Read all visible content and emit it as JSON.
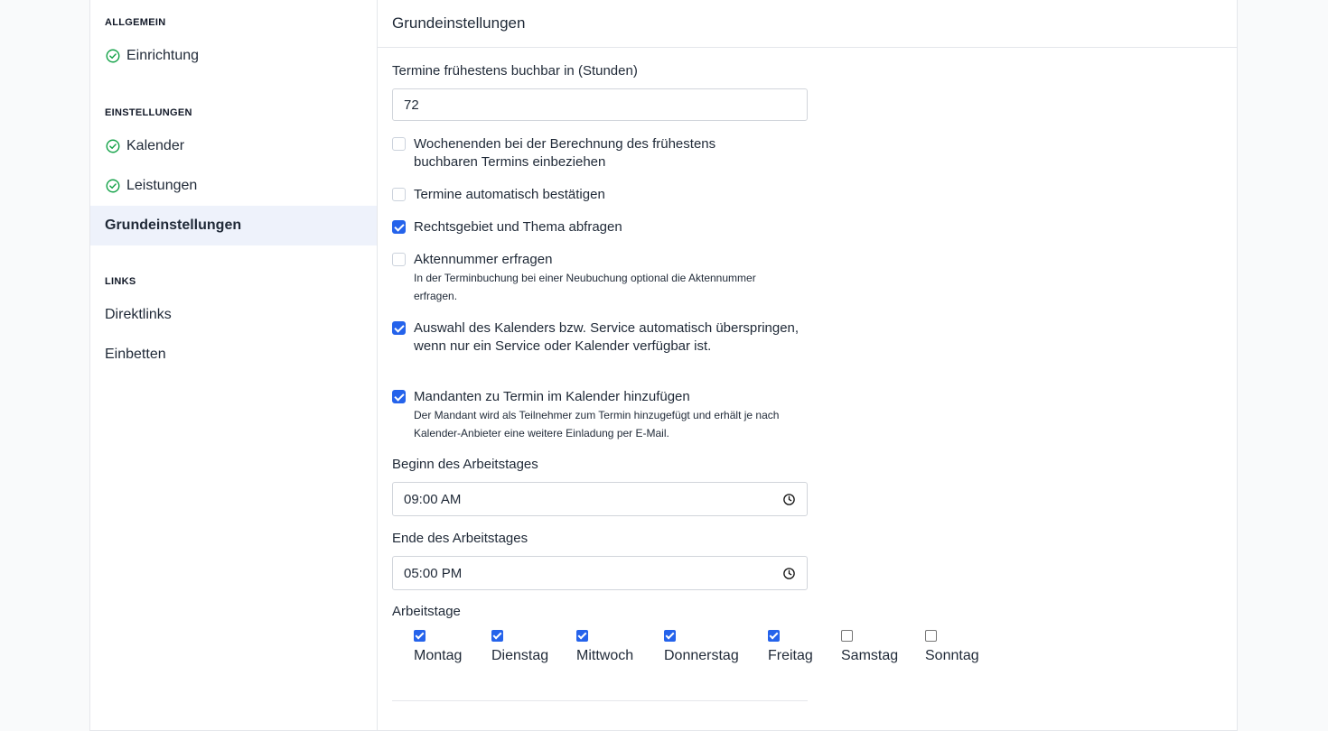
{
  "sidebar": {
    "sections": [
      {
        "title": "ALLGEMEIN",
        "items": [
          {
            "label": "Einrichtung",
            "done": true
          }
        ]
      },
      {
        "title": "EINSTELLUNGEN",
        "items": [
          {
            "label": "Kalender",
            "done": true
          },
          {
            "label": "Leistungen",
            "done": true
          },
          {
            "label": "Grundeinstellungen",
            "done": false,
            "active": true
          }
        ]
      },
      {
        "title": "LINKS",
        "items": [
          {
            "label": "Direktlinks"
          },
          {
            "label": "Einbetten"
          }
        ]
      }
    ]
  },
  "main": {
    "title": "Grundeinstellungen",
    "lead_time": {
      "label": "Termine frühestens buchbar in (Stunden)",
      "value": "72"
    },
    "options": [
      {
        "label": "Wochenenden bei der Berechnung des frühestens buchbaren Termins einbeziehen",
        "checked": false,
        "desc": ""
      },
      {
        "label": "Termine automatisch bestätigen",
        "checked": false,
        "desc": ""
      },
      {
        "label": "Rechtsgebiet und Thema abfragen",
        "checked": true,
        "desc": ""
      },
      {
        "label": "Aktennummer erfragen",
        "checked": false,
        "desc": "In der Terminbuchung bei einer Neubuchung optional die Aktennummer erfragen."
      },
      {
        "label": "Auswahl des Kalenders bzw. Service automatisch überspringen, wenn nur ein Service oder Kalender verfügbar ist.",
        "checked": true,
        "desc": ""
      },
      {
        "label": "Mandanten zu Termin im Kalender hinzufügen",
        "checked": true,
        "desc": "Der Mandant wird als Teilnehmer zum Termin hinzugefügt und erhält je nach Kalender-Anbieter eine weitere Einladung per E-Mail."
      }
    ],
    "work_start": {
      "label": "Beginn des Arbeitstages",
      "value": "09:00 AM"
    },
    "work_end": {
      "label": "Ende des Arbeitstages",
      "value": "05:00 PM"
    },
    "workdays": {
      "label": "Arbeitstage",
      "days": [
        {
          "label": "Montag",
          "checked": true
        },
        {
          "label": "Dienstag",
          "checked": true
        },
        {
          "label": "Mittwoch",
          "checked": true
        },
        {
          "label": "Donnerstag",
          "checked": true
        },
        {
          "label": "Freitag",
          "checked": true
        },
        {
          "label": "Samstag",
          "checked": false
        },
        {
          "label": "Sonntag",
          "checked": false
        }
      ]
    }
  },
  "colors": {
    "accent": "#2563eb",
    "success": "#16a34a",
    "active_bg": "#eef2fb"
  }
}
